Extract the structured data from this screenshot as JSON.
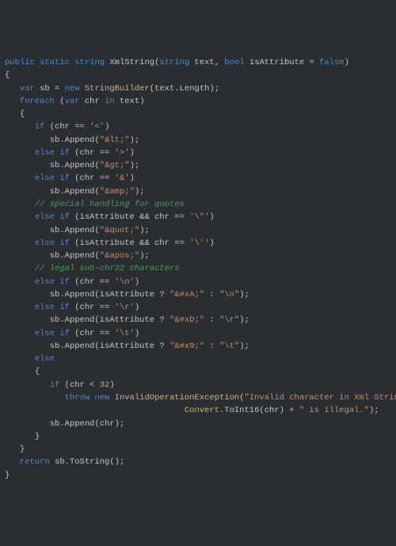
{
  "kw": {
    "public": "public",
    "static": "static",
    "string": "string",
    "bool": "bool",
    "var": "var",
    "new": "new",
    "foreach": "foreach",
    "in": "in",
    "if": "if",
    "elseif": "else if",
    "else": "else",
    "return": "return",
    "throw": "throw",
    "false": "false"
  },
  "typ": {
    "StringBuilder": "StringBuilder",
    "InvalidOperationException": "InvalidOperationException",
    "Convert": "Convert"
  },
  "id": {
    "XmlString": "XmlString",
    "text": "text",
    "isAttribute": "isAttribute",
    "sb": "sb",
    "chr": "chr",
    "Length": "Length",
    "Append": "Append",
    "ToString": "ToString",
    "ToInt16": "ToInt16"
  },
  "chrlit": {
    "lt": "'<'",
    "gt": "'>'",
    "amp": "'&'",
    "dq": "'\\\"'",
    "sq": "'\\''",
    "nl": "'\\n'",
    "cr": "'\\r'",
    "tb": "'\\t'"
  },
  "strlit": {
    "lt": "\"&lt;\"",
    "gt": "\"&gt;\"",
    "amp": "\"&amp;\"",
    "quot": "\"&quot;\"",
    "apos": "\"&apos;\"",
    "xa": "\"&#xA;\"",
    "nl": "\"\\n\"",
    "xd": "\"&#xD;\"",
    "cr": "\"\\r\"",
    "x9": "\"&#x9;\"",
    "tb": "\"\\t\"",
    "err1": "\"Invalid character in Xml String. Chr \"",
    "err2": "\" is illegal.\""
  },
  "num": {
    "n32": "32"
  },
  "cmt": {
    "quotes": "// special handling for quotes",
    "legal": "// legal sub-chr32 characters"
  },
  "pun": {
    "lparen": "(",
    "rparen": ")",
    "lbrace": "{",
    "rbrace": "}",
    "comma": ", ",
    "semi": ";",
    "assign": " = ",
    "eq": " == ",
    "dot": ".",
    "qm": " ? ",
    "colon": " : ",
    "and": " && ",
    "lt": " < ",
    "plus": " + "
  }
}
